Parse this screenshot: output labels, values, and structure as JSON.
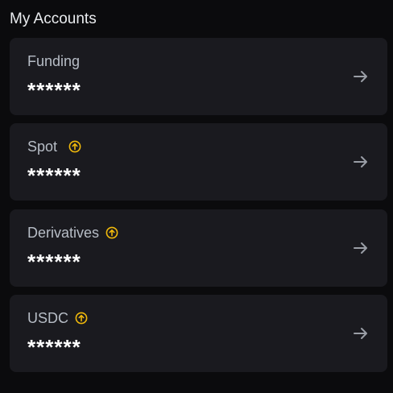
{
  "section": {
    "title": "My Accounts"
  },
  "accounts": [
    {
      "name": "Funding",
      "balance": "******",
      "has_transfer_icon": false
    },
    {
      "name": "Spot",
      "balance": "******",
      "has_transfer_icon": true
    },
    {
      "name": "Derivatives",
      "balance": "******",
      "has_transfer_icon": true
    },
    {
      "name": "USDC",
      "balance": "******",
      "has_transfer_icon": true
    }
  ],
  "icons": {
    "transfer": "arrow-up-circle-icon",
    "navigate": "arrow-right-icon"
  },
  "colors": {
    "background": "#0b0b0d",
    "card": "#1a1a1f",
    "accent": "#f0b90b",
    "label": "#b7bdc6",
    "value": "#ffffff",
    "arrow": "#9a9ea6"
  }
}
